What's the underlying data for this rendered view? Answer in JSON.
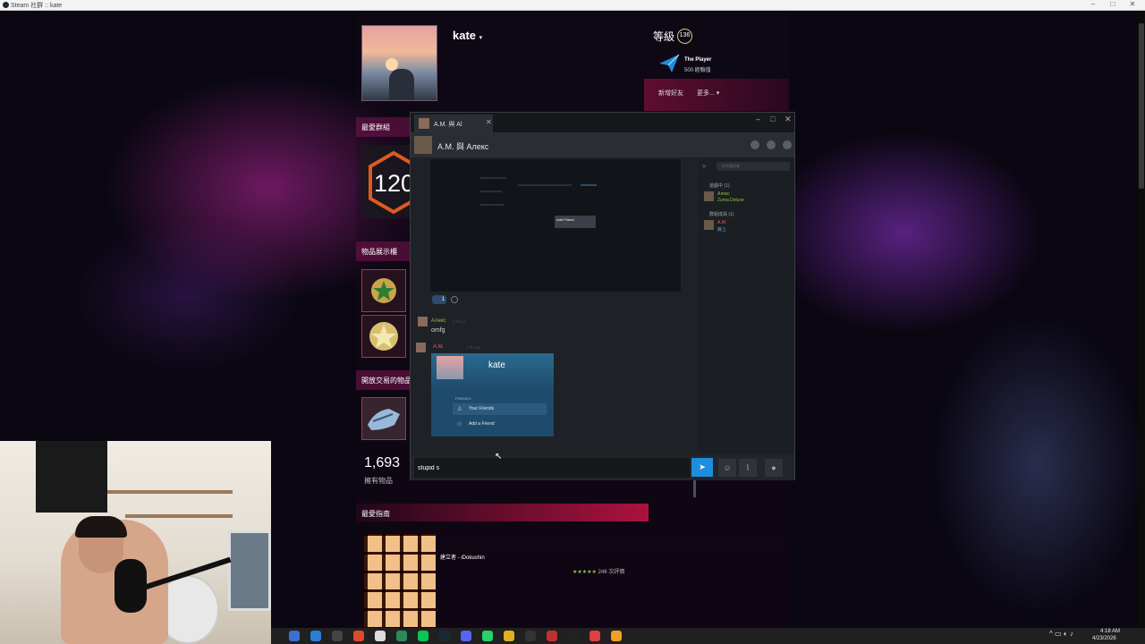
{
  "os": {
    "window_title": "Steam 社群 :: kate",
    "controls": [
      "–",
      "□",
      "✕"
    ]
  },
  "profile": {
    "username": "kate",
    "level_label": "等級",
    "level": "136",
    "badge_title": "The Player",
    "badge_xp": "500 經驗值",
    "add_friend": "新增好友",
    "more": "更多...",
    "fav_group_label": "最愛群組",
    "group_number": "120",
    "showcase_label": "物品展示櫃",
    "trade_label": "開放交易的物品",
    "items_count": "1,693",
    "items_label": "擁有物品",
    "fav_guide_label": "最愛指南",
    "guide_author": "建立者 - ιDokushin",
    "guide_stars": "★★★★★",
    "guide_ratings": "248 次評價"
  },
  "chat": {
    "tab_label": "A.M. 與 Al",
    "header_title": "A.M. 與 Алекс",
    "screenshot_tooltip": "Add Friend",
    "reaction_count": "1",
    "messages": [
      {
        "name": "Алекс",
        "time": "上午4:16",
        "text": "omfg",
        "name_color": "#8fc63e"
      },
      {
        "name": "A.M.",
        "time": "上午4:18",
        "text": "",
        "name_color": "#e05a5a"
      }
    ],
    "profile_card": {
      "name": "kate",
      "friends_label": "FRIENDS",
      "your_friends": "Your Friends",
      "add_friend": "Add a Friend"
    },
    "members": {
      "search_placeholder": "依名稱搜尋",
      "in_game_header": "遊戲中 (1)",
      "in_game_name": "Алекс",
      "in_game_game": "Zuma Deluxe",
      "group_header": "群組成員 (1)",
      "group_member": "A.M.",
      "group_member_status": "線上"
    },
    "input_value": "stupid s",
    "send_icon": "send-icon"
  },
  "taskbar": {
    "time": "4:18 AM",
    "date": "4/23/2026",
    "icons": [
      "search-icon",
      "chrome-icon",
      "epic-icon",
      "browser-icon",
      "app-icon",
      "app-icon",
      "line-icon",
      "steam-icon",
      "discord-icon",
      "whatsapp-icon",
      "app-icon",
      "app-icon",
      "game-icon",
      "app-icon",
      "app-icon",
      "app-icon"
    ],
    "icon_colors": [
      "#3b6fd4",
      "#2a7fd4",
      "#444",
      "#e04a2a",
      "#ddd",
      "#2a8a5a",
      "#06c755",
      "#1b2838",
      "#5865f2",
      "#25d366",
      "#e0b020",
      "#333",
      "#c03030",
      "#222",
      "#e04040",
      "#f0a020"
    ]
  }
}
